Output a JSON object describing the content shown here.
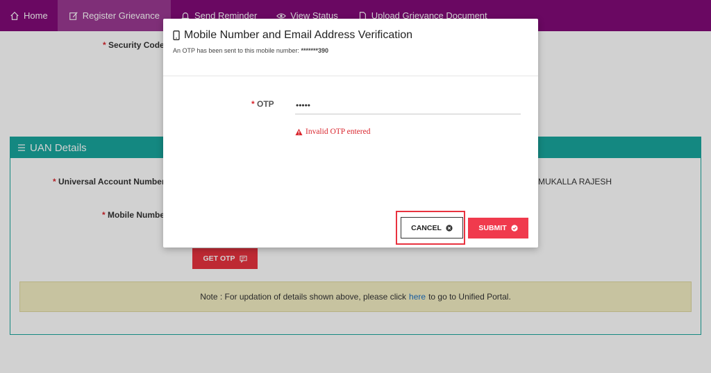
{
  "navbar": {
    "items": [
      {
        "label": "Home",
        "icon": "home-icon"
      },
      {
        "label": "Register Grievance",
        "icon": "edit-icon",
        "active": true
      },
      {
        "label": "Send Reminder",
        "icon": "bell-icon"
      },
      {
        "label": "View Status",
        "icon": "eye-icon"
      },
      {
        "label": "Upload Grievance Document",
        "icon": "document-icon"
      }
    ],
    "color": "#820a78"
  },
  "form": {
    "security_code_label": "Security Code"
  },
  "uan_details": {
    "title": "UAN Details",
    "uan_label": "Universal Account Number",
    "mobile_label": "Mobile Number",
    "name_value": "MUKALLA RAJESH",
    "get_otp_label": "GET OTP",
    "note_prefix": "Note : For updation of details shown above, please click",
    "note_link": "here",
    "note_suffix": "to go to Unified Portal.",
    "color": "#19a79e"
  },
  "modal": {
    "title": "Mobile Number and Email Address Verification",
    "subtitle_prefix": "An OTP has been sent to this mobile number:",
    "masked_mobile": "*******390",
    "otp_label": "OTP",
    "otp_value": "•••••",
    "error_text": "Invalid OTP entered",
    "cancel_label": "CANCEL",
    "submit_label": "SUBMIT",
    "submit_color": "#f03a4d"
  }
}
